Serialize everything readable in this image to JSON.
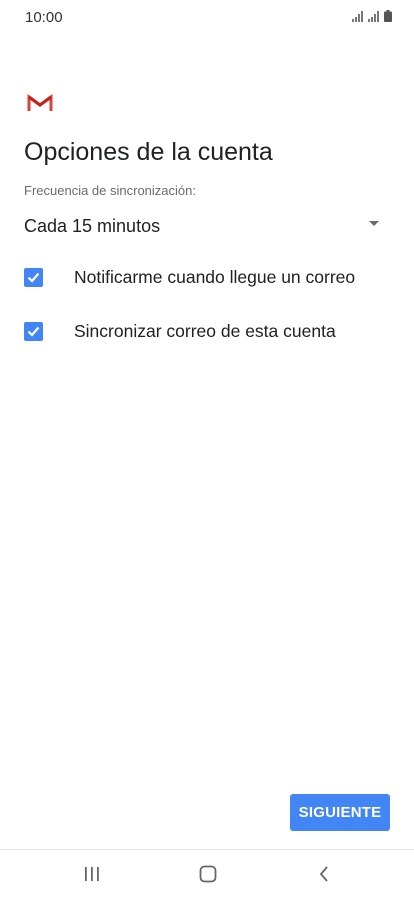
{
  "status_bar": {
    "time": "10:00"
  },
  "app": {
    "logo_icon": "gmail-logo-icon",
    "brand_color": "#d44638"
  },
  "page": {
    "title": "Opciones de la cuenta"
  },
  "sync_frequency": {
    "label": "Frecuencia de sincronización:",
    "selected_value": "Cada 15 minutos"
  },
  "options": [
    {
      "label": "Notificarme cuando llegue un correo",
      "checked": true
    },
    {
      "label": "Sincronizar correo de esta cuenta",
      "checked": true
    }
  ],
  "actions": {
    "next_label": "SIGUIENTE"
  },
  "nav_bar": {
    "recents_icon": "recents-icon",
    "home_icon": "home-icon",
    "back_icon": "back-icon"
  },
  "colors": {
    "accent": "#4285f4",
    "text_primary": "#202124",
    "text_secondary": "#6b6b6b"
  }
}
